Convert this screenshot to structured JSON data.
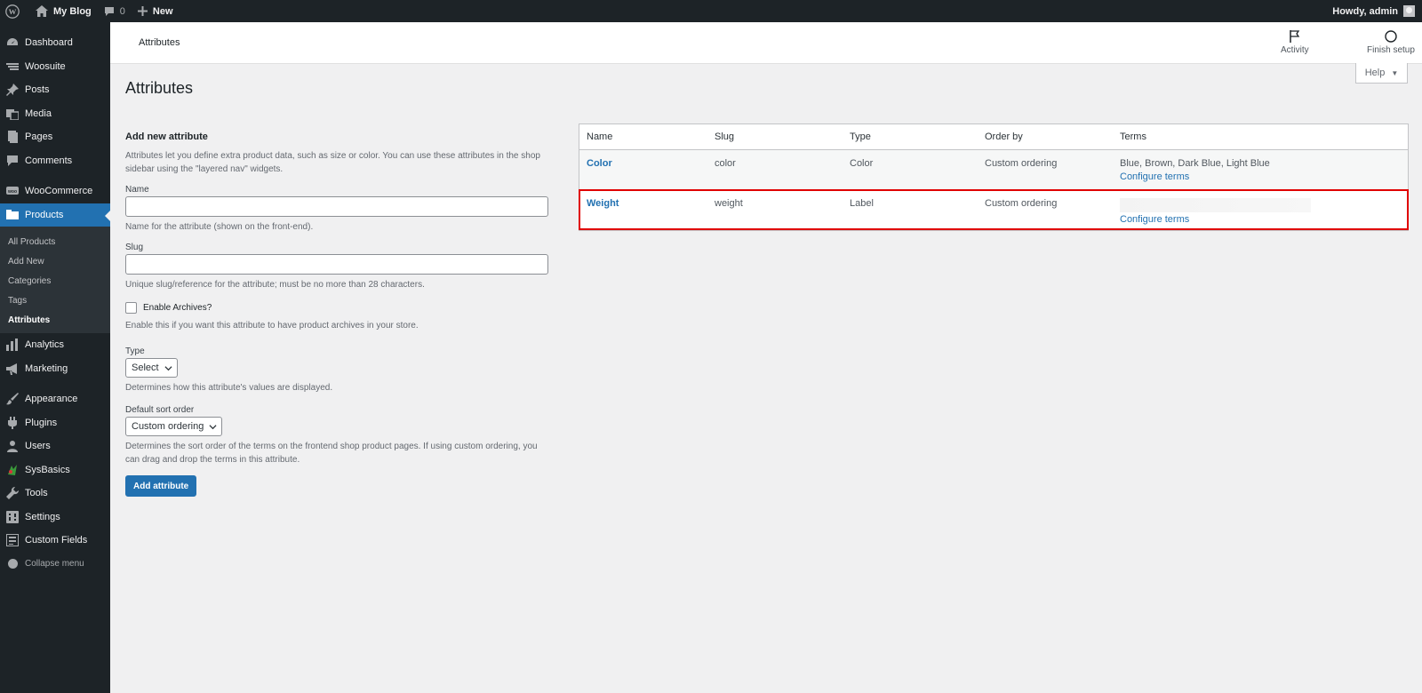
{
  "adminbar": {
    "site_name": "My Blog",
    "comments_count": "0",
    "new_label": "New",
    "howdy": "Howdy, admin"
  },
  "sidebar": {
    "items": [
      {
        "label": "Dashboard",
        "icon": "dashboard-icon"
      },
      {
        "label": "Woosuite",
        "icon": "woosuite-icon"
      },
      {
        "label": "Posts",
        "icon": "pin-icon"
      },
      {
        "label": "Media",
        "icon": "media-icon"
      },
      {
        "label": "Pages",
        "icon": "pages-icon"
      },
      {
        "label": "Comments",
        "icon": "comment-icon"
      },
      {
        "label": "WooCommerce",
        "icon": "woocommerce-icon"
      },
      {
        "label": "Products",
        "icon": "products-icon"
      },
      {
        "label": "Analytics",
        "icon": "analytics-icon"
      },
      {
        "label": "Marketing",
        "icon": "megaphone-icon"
      },
      {
        "label": "Appearance",
        "icon": "brush-icon"
      },
      {
        "label": "Plugins",
        "icon": "plugin-icon"
      },
      {
        "label": "Users",
        "icon": "users-icon"
      },
      {
        "label": "SysBasics",
        "icon": "sysbasics-icon"
      },
      {
        "label": "Tools",
        "icon": "wrench-icon"
      },
      {
        "label": "Settings",
        "icon": "settings-icon"
      },
      {
        "label": "Custom Fields",
        "icon": "custom-fields-icon"
      }
    ],
    "submenu": [
      "All Products",
      "Add New",
      "Categories",
      "Tags",
      "Attributes"
    ],
    "collapse_label": "Collapse menu"
  },
  "header": {
    "page_label": "Attributes",
    "activity_label": "Activity",
    "finish_setup_label": "Finish setup"
  },
  "help_label": "Help",
  "page_title": "Attributes",
  "form": {
    "heading": "Add new attribute",
    "intro": "Attributes let you define extra product data, such as size or color. You can use these attributes in the shop sidebar using the \"layered nav\" widgets.",
    "name_label": "Name",
    "name_desc": "Name for the attribute (shown on the front-end).",
    "slug_label": "Slug",
    "slug_desc": "Unique slug/reference for the attribute; must be no more than 28 characters.",
    "archives_label": "Enable Archives?",
    "archives_desc": "Enable this if you want this attribute to have product archives in your store.",
    "type_label": "Type",
    "type_value": "Select",
    "type_desc": "Determines how this attribute's values are displayed.",
    "sort_label": "Default sort order",
    "sort_value": "Custom ordering",
    "sort_desc": "Determines the sort order of the terms on the frontend shop product pages. If using custom ordering, you can drag and drop the terms in this attribute.",
    "submit_label": "Add attribute"
  },
  "table": {
    "headers": {
      "name": "Name",
      "slug": "Slug",
      "type": "Type",
      "order": "Order by",
      "terms": "Terms"
    },
    "rows": [
      {
        "name": "Color",
        "slug": "color",
        "type": "Color",
        "order": "Custom ordering",
        "terms": "Blue, Brown, Dark Blue, Light Blue",
        "configure": "Configure terms"
      },
      {
        "name": "Weight",
        "slug": "weight",
        "type": "Label",
        "order": "Custom ordering",
        "terms": "",
        "configure": "Configure terms"
      }
    ]
  },
  "colors": {
    "accent": "#2271b1",
    "adminbar_bg": "#1d2327",
    "highlight_border": "#e00000"
  }
}
